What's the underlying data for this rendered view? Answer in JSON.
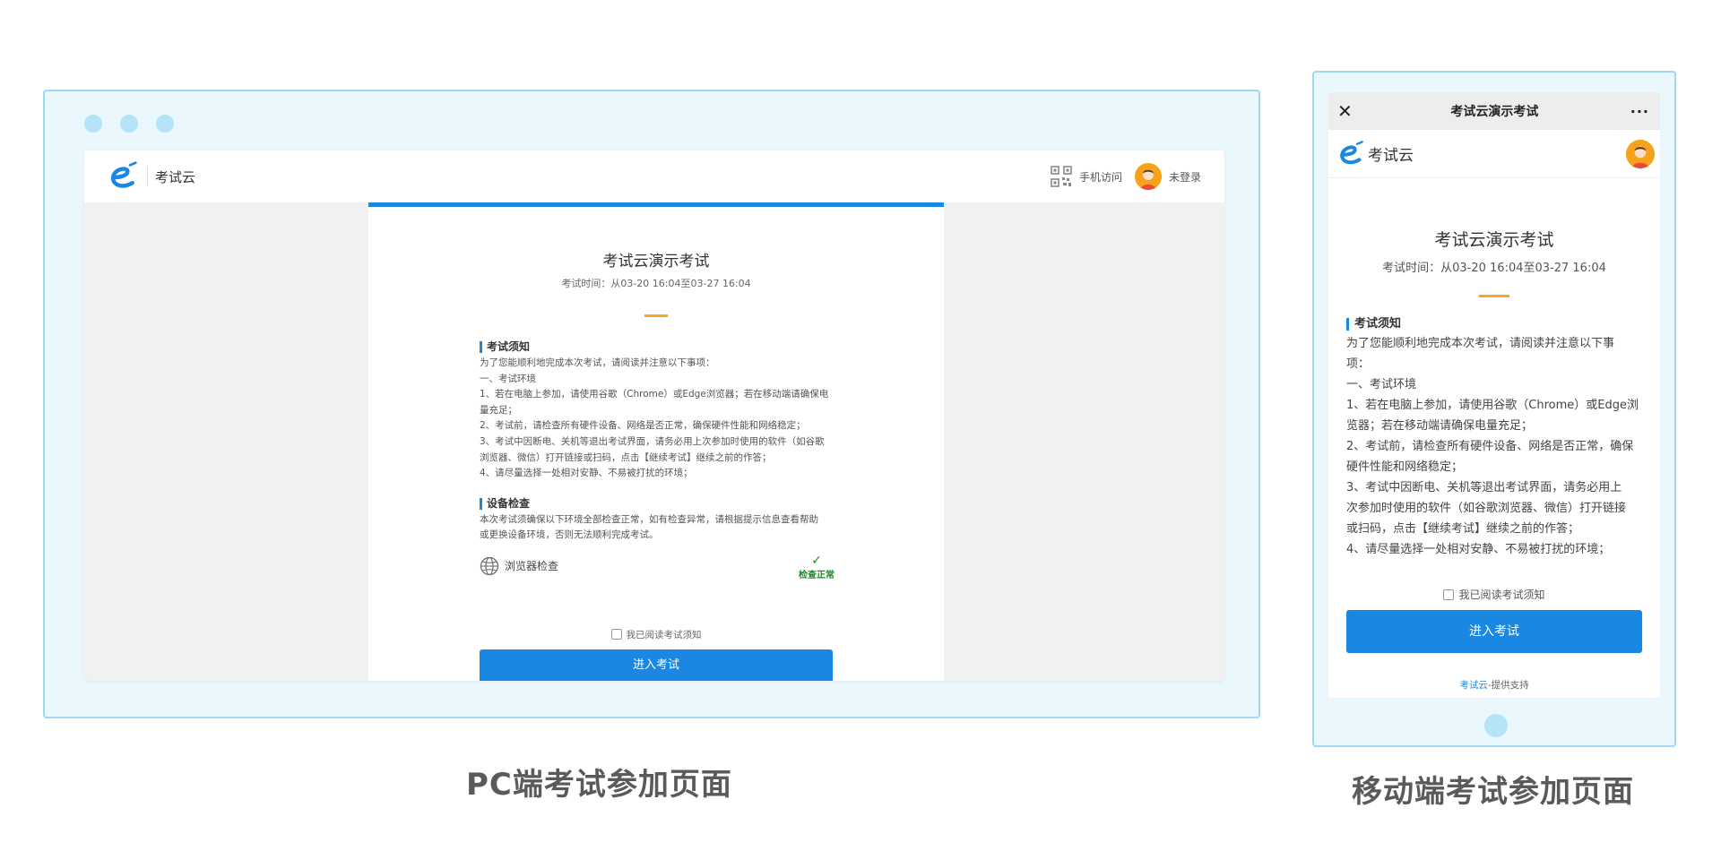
{
  "pc": {
    "logo_text": "考试云",
    "mobile_access": "手机访问",
    "login_status": "未登录",
    "exam_title": "考试云演示考试",
    "exam_time": "考试时间：从03-20 16:04至03-27 16:04",
    "notice_title": "考试须知",
    "notice_lines": [
      "为了您能顺利地完成本次考试，请阅读并注意以下事项：",
      "一、考试环境",
      "1、若在电脑上参加，请使用谷歌（Chrome）或Edge浏览器；若在移动端请确保电",
      "量充足；",
      "2、考试前，请检查所有硬件设备、网络是否正常，确保硬件性能和网络稳定；",
      "3、考试中因断电、关机等退出考试界面，请务必用上次参加时使用的软件（如谷歌",
      "浏览器、微信）打开链接或扫码，点击【继续考试】继续之前的作答；",
      "4、请尽量选择一处相对安静、不易被打扰的环境；"
    ],
    "device_title": "设备检查",
    "device_lines": [
      "本次考试须确保以下环境全部检查正常，如有检查异常，请根据提示信息查看帮助",
      "或更换设备环境，否则无法顺利完成考试。"
    ],
    "browser_check": "浏览器检查",
    "check_ok": "检查正常",
    "agree_label": "我已阅读考试须知",
    "enter_button": "进入考试",
    "caption": "PC端考试参加页面"
  },
  "mobile": {
    "topbar_title": "考试云演示考试",
    "close_glyph": "✕",
    "more_glyph": "···",
    "logo_text": "考试云",
    "exam_title": "考试云演示考试",
    "exam_time": "考试时间：从03-20 16:04至03-27 16:04",
    "notice_title": "考试须知",
    "notice_lines": [
      "为了您能顺利地完成本次考试，请阅读并注意以下事",
      "项：",
      "一、考试环境",
      "1、若在电脑上参加，请使用谷歌（Chrome）或Edge浏",
      "览器；若在移动端请确保电量充足；",
      "2、考试前，请检查所有硬件设备、网络是否正常，确保",
      "硬件性能和网络稳定；",
      "3、考试中因断电、关机等退出考试界面，请务必用上",
      "次参加时使用的软件（如谷歌浏览器、微信）打开链接",
      "或扫码，点击【继续考试】继续之前的作答；",
      "4、请尽量选择一处相对安静、不易被打扰的环境；"
    ],
    "agree_label": "我已阅读考试须知",
    "enter_button": "进入考试",
    "footer_brand": "考试云",
    "footer_rest": "-提供支持",
    "caption": "移动端考试参加页面"
  },
  "colors": {
    "accent": "#1a88e2",
    "divider_orange": "#f5a623",
    "ok_green": "#1d8a2e",
    "frame_bg": "#eaf7fd",
    "frame_border": "#9ed8f2"
  },
  "icons": [
    "logo-e-icon",
    "qr-code-icon",
    "avatar-icon",
    "globe-icon",
    "checkmark-icon",
    "close-icon",
    "more-icon"
  ]
}
